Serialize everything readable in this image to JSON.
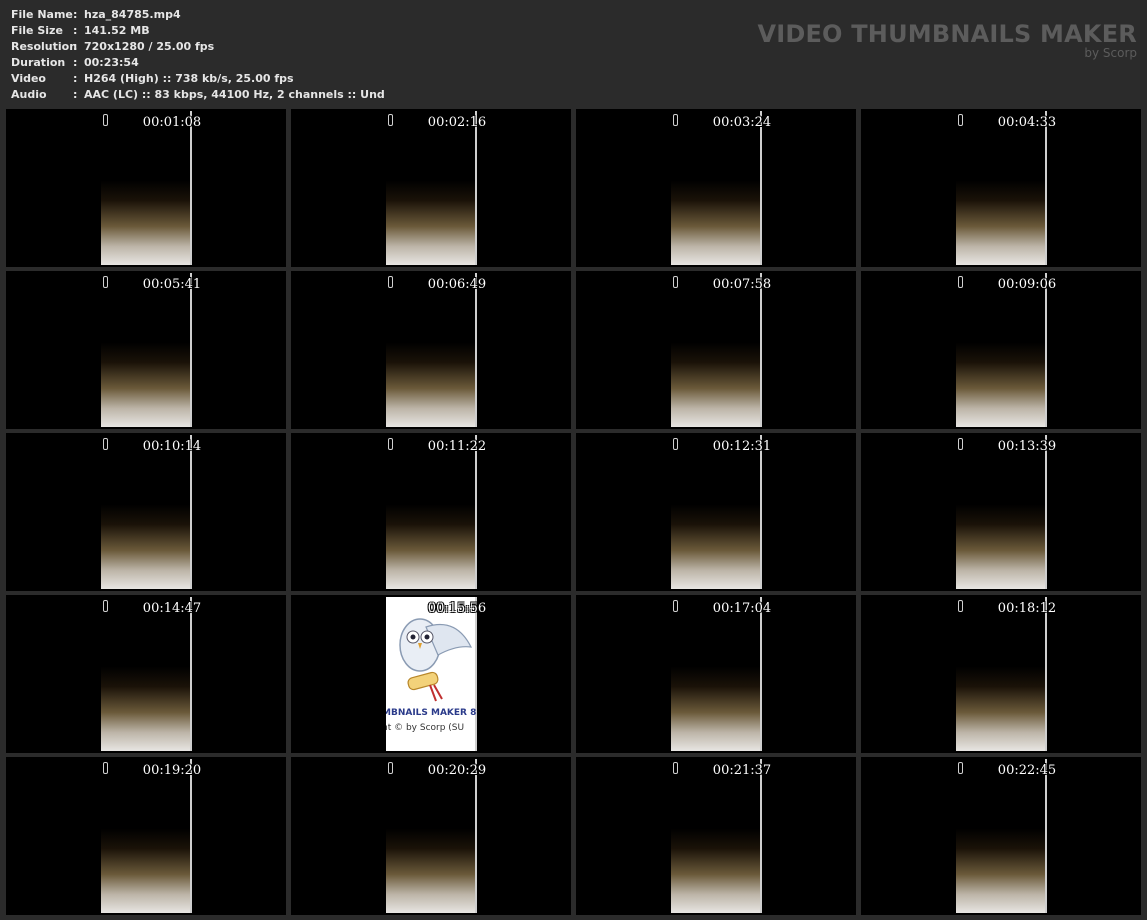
{
  "file_info": [
    {
      "key": "File Name",
      "sep": ":",
      "value": "hza_84785.mp4"
    },
    {
      "key": "File Size",
      "sep": ":",
      "value": "141.52 MB"
    },
    {
      "key": "Resolution",
      "sep": ":",
      "value": "720x1280 / 25.00 fps"
    },
    {
      "key": "Duration",
      "sep": ":",
      "value": "00:23:54"
    },
    {
      "key": "Video",
      "sep": ":",
      "value": "H264 (High) :: 738 kb/s, 25.00 fps"
    },
    {
      "key": "Audio",
      "sep": ":",
      "value": "AAC (LC) :: 83 kbps, 44100 Hz, 2 channels :: Und"
    }
  ],
  "brand": {
    "title": "VIDEO THUMBNAILS MAKER",
    "subtitle": "by Scorp"
  },
  "thumbnails": [
    {
      "time": "00:01:08"
    },
    {
      "time": "00:02:16"
    },
    {
      "time": "00:03:24"
    },
    {
      "time": "00:04:33"
    },
    {
      "time": "00:05:41"
    },
    {
      "time": "00:06:49"
    },
    {
      "time": "00:07:58"
    },
    {
      "time": "00:09:06"
    },
    {
      "time": "00:10:14"
    },
    {
      "time": "00:11:22"
    },
    {
      "time": "00:12:31"
    },
    {
      "time": "00:13:39"
    },
    {
      "time": "00:14:47"
    },
    {
      "time": "00:15:56",
      "owl": true,
      "owl_line1": "MBNAILS MAKER 8",
      "owl_line2": "nt © by Scorp (SU"
    },
    {
      "time": "00:17:04"
    },
    {
      "time": "00:18:12"
    },
    {
      "time": "00:19:20"
    },
    {
      "time": "00:20:29"
    },
    {
      "time": "00:21:37"
    },
    {
      "time": "00:22:45"
    }
  ],
  "colors": {
    "background": "#2b2b2b",
    "brand_text": "#5c5c5c",
    "meta_text": "#e6e6e6",
    "timestamp": "#ffffff"
  }
}
